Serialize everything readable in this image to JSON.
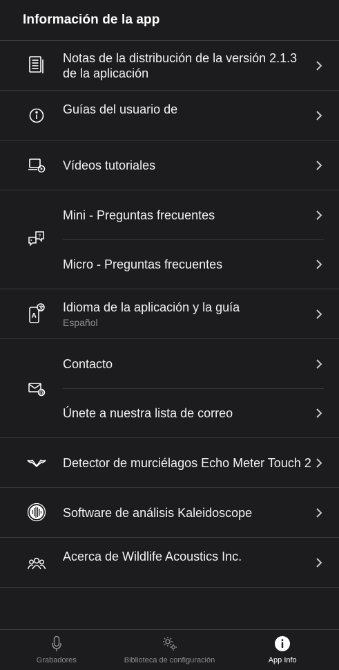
{
  "header": {
    "title": "Información de la app"
  },
  "items": {
    "release_notes": "Notas de la distribución de la versión 2.1.3 de la aplicación",
    "user_guides": "Guías del usuario de",
    "tutorials": "Vídeos tutoriales",
    "mini_faq": "Mini - Preguntas frecuentes",
    "micro_faq": "Micro - Preguntas frecuentes",
    "language": "Idioma de la aplicación y la guía",
    "language_value": "Español",
    "contact": "Contacto",
    "mailing_list": "Únete a nuestra lista de correo",
    "bat_detector": "Detector de murciélagos Echo Meter Touch 2",
    "kaleidoscope": "Software de análisis Kaleidoscope",
    "about": "Acerca de Wildlife Acoustics Inc."
  },
  "tabs": {
    "recorders": "Grabadores",
    "config_library": "Biblioteca de configuración",
    "app_info": "App Info"
  },
  "colors": {
    "background": "#1c1c1e",
    "separator": "#3a3a3c",
    "secondary_text": "#8e8e93"
  }
}
